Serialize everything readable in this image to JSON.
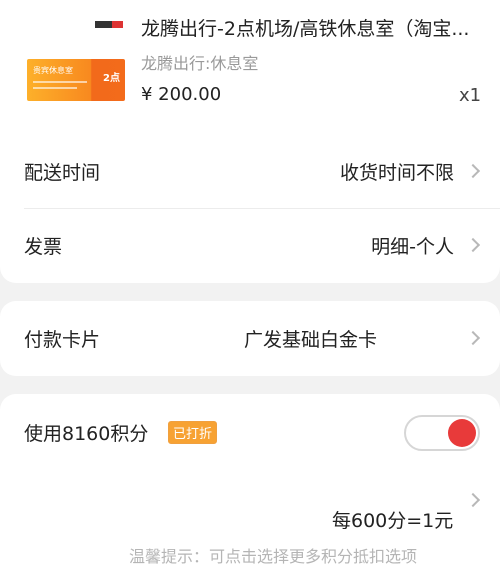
{
  "product": {
    "title": "龙腾出行-2点机场/高铁休息室（淘宝...",
    "subtitle": "龙腾出行:休息室",
    "price": "¥ 200.00",
    "quantity": "x1",
    "thumbnail_text": "贵宾休息室",
    "thumbnail_badge": "2点"
  },
  "delivery": {
    "label": "配送时间",
    "value": "收货时间不限"
  },
  "invoice": {
    "label": "发票",
    "value": "明细-个人"
  },
  "payment_card": {
    "label": "付款卡片",
    "value": "广发基础白金卡"
  },
  "points": {
    "label": "使用8160积分",
    "badge": "已打折",
    "toggle_on": true,
    "rate": "每600分=1元",
    "tip": "温馨提示：可点击选择更多积分抵扣选项"
  },
  "colors": {
    "accent_red": "#e83a3a",
    "badge_orange": "#f7a233",
    "background": "#f2f2f2"
  }
}
